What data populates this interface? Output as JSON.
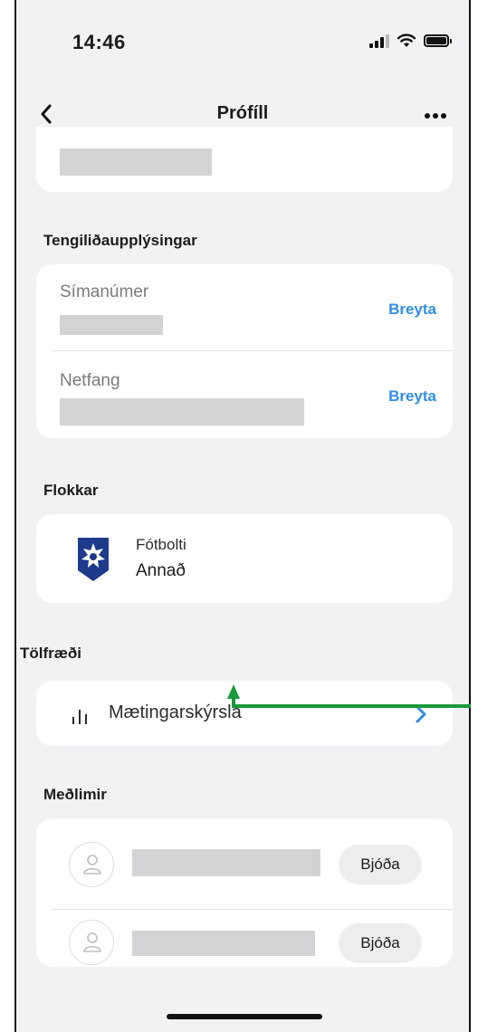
{
  "status_bar": {
    "time": "14:46"
  },
  "header": {
    "title": "Prófíll",
    "back_icon": "chevron-left-icon",
    "more_icon": "more-horizontal-icon"
  },
  "contact": {
    "section_title": "Tengiliðaupplýsingar",
    "phone_label": "Símanúmer",
    "email_label": "Netfang",
    "edit_label": "Breyta"
  },
  "categories": {
    "section_title": "Flokkar",
    "sport": "Fótbolti",
    "team": "Annað"
  },
  "statistics": {
    "section_title": "Tölfræði",
    "attendance_label": "Mætingarskýrsla"
  },
  "members": {
    "section_title": "Meðlimir",
    "invite_label": "Bjóða"
  },
  "colors": {
    "accent": "#2f8ee8",
    "annotation": "#1a9a3a",
    "logo": "#1e3a8a"
  }
}
